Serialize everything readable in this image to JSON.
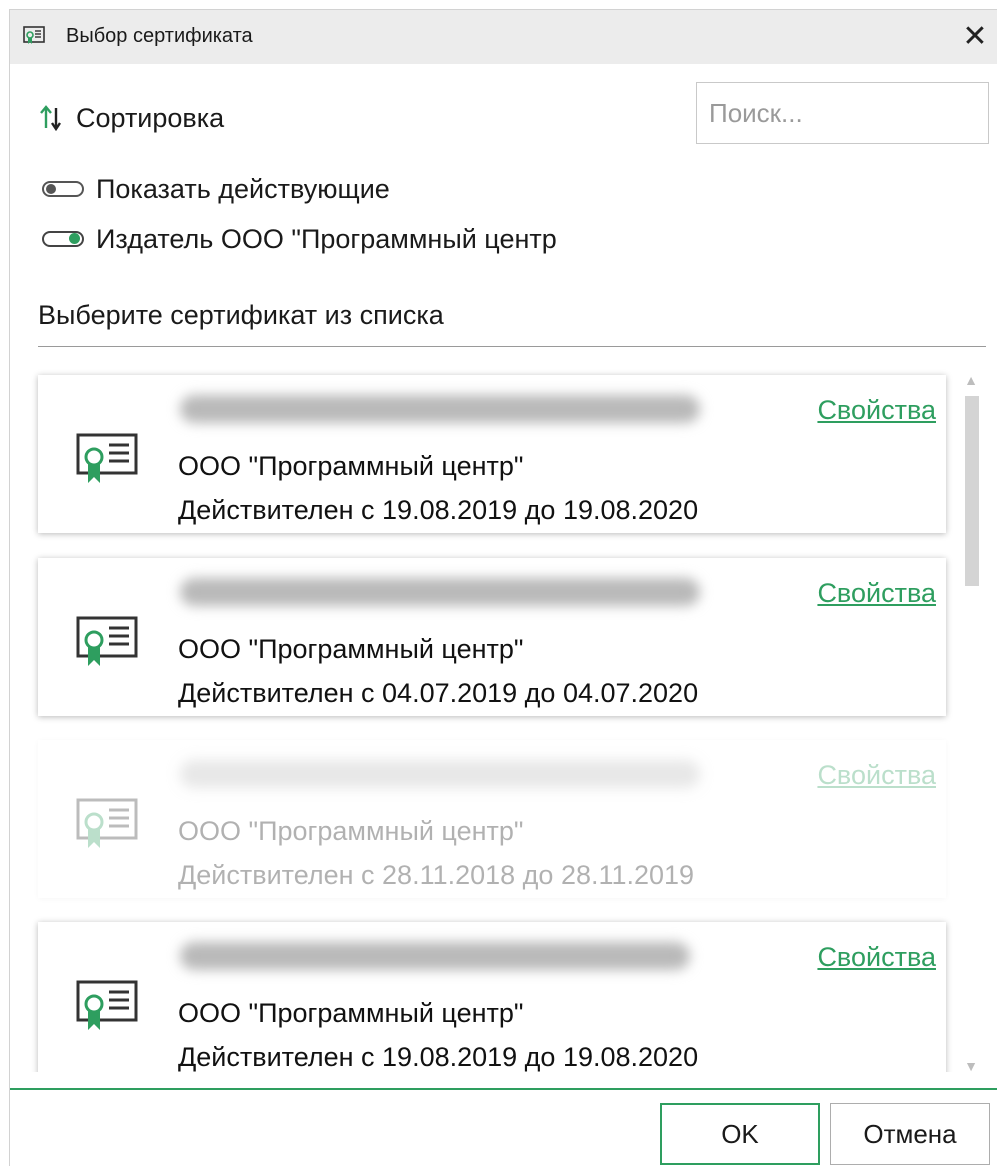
{
  "window": {
    "title": "Выбор сертификата",
    "close_label": "✕"
  },
  "toolbar": {
    "sort_label": "Сортировка",
    "search_placeholder": "Поиск...",
    "search_value": ""
  },
  "filters": [
    {
      "label": "Показать действующие",
      "enabled": false
    },
    {
      "label": "Издатель ООО \"Программный центр",
      "enabled": true
    }
  ],
  "list": {
    "title": "Выберите сертификат из списка",
    "properties_label": "Свойства",
    "items": [
      {
        "name_hidden": true,
        "organization": "ООО \"Программный центр\"",
        "validity": "Действителен с 19.08.2019 до 19.08.2020",
        "active": true
      },
      {
        "name_hidden": true,
        "organization": "ООО \"Программный центр\"",
        "validity": "Действителен с 04.07.2019 до 04.07.2020",
        "active": true
      },
      {
        "name_hidden": true,
        "organization": "ООО \"Программный центр\"",
        "validity": "Действителен с 28.11.2018 до 28.11.2019",
        "active": false
      },
      {
        "name_hidden": true,
        "organization": "ООО \"Программный центр\"",
        "validity": "Действителен с 19.08.2019 до 19.08.2020",
        "active": true
      }
    ]
  },
  "footer": {
    "ok_label": "OK",
    "cancel_label": "Отмена"
  },
  "colors": {
    "accent": "#2e9e5f",
    "titlebar": "#ececec"
  },
  "icons": {
    "window": "certificate-icon",
    "sort": "sort-icon",
    "close": "close-icon",
    "item": "certificate-icon"
  }
}
